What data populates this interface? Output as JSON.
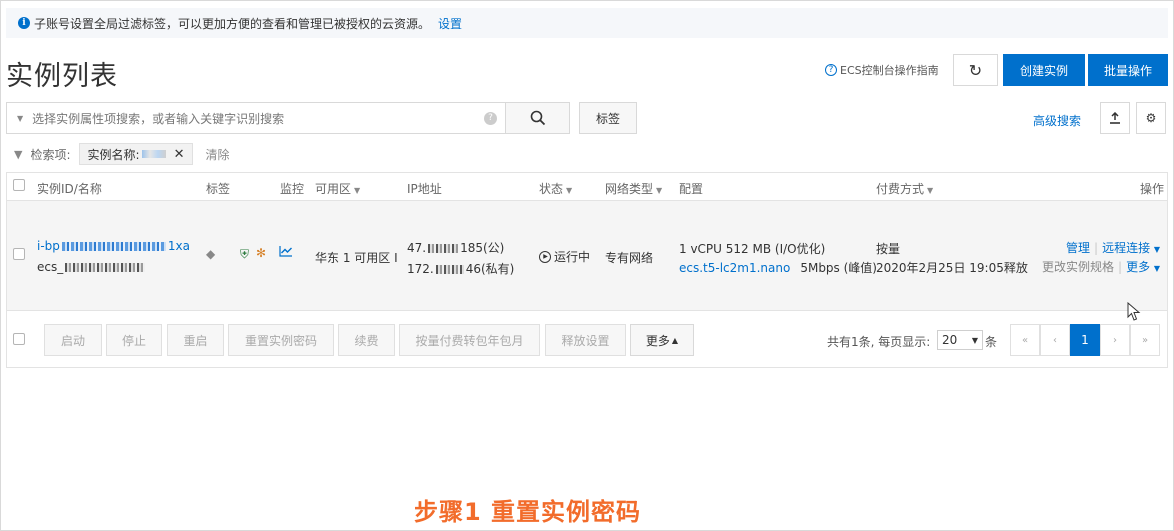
{
  "notice": {
    "text": "子账号设置全局过滤标签，可以更加方便的查看和管理已被授权的云资源。",
    "link": "设置"
  },
  "header": {
    "title": "实例列表",
    "guide_label": "ECS控制台操作指南",
    "create_label": "创建实例",
    "batch_label": "批量操作"
  },
  "search": {
    "placeholder": "选择实例属性项搜索，或者输入关键字识别搜索",
    "tag_label": "标签",
    "advanced_label": "高级搜索"
  },
  "filter": {
    "label": "检索项:",
    "chip": "实例名称:",
    "clear": "清除"
  },
  "table": {
    "columns": {
      "id_name": "实例ID/名称",
      "tags": "标签",
      "monitor": "监控",
      "zone": "可用区",
      "ip": "IP地址",
      "status": "状态",
      "network": "网络类型",
      "config": "配置",
      "billing": "付费方式",
      "actions": "操作"
    },
    "row": {
      "id_prefix": "i-bp",
      "id_suffix": "1xa",
      "name_prefix": "ecs_",
      "zone": "华东 1 可用区 I",
      "ip_public_prefix": "47.",
      "ip_public_suffix": "185(公)",
      "ip_private_prefix": "172.",
      "ip_private_suffix": "46(私有)",
      "status": "运行中",
      "network": "专有网络",
      "config_spec": "1 vCPU 512 MB (I/O优化)",
      "config_type": "ecs.t5-lc2m1.nano",
      "bandwidth": "5Mbps (峰值)",
      "billing": "按量",
      "created": "2020年2月25日 19:05释放",
      "action_manage": "管理",
      "action_remote": "远程连接",
      "action_change": "更改实例规格",
      "action_more": "更多"
    }
  },
  "footer": {
    "start": "启动",
    "stop": "停止",
    "restart": "重启",
    "reset_password": "重置实例密码",
    "renew": "续费",
    "convert": "按量付费转包年包月",
    "release": "释放设置",
    "more": "更多",
    "total": "共有1条, 每页显示:",
    "page_size": "20",
    "per_unit": "条",
    "pages": [
      "«",
      "‹",
      "1",
      "›",
      "»"
    ]
  },
  "caption": "步骤1 重置实例密码",
  "colors": {
    "accent": "#0070cc",
    "caption": "#f26c2b"
  }
}
